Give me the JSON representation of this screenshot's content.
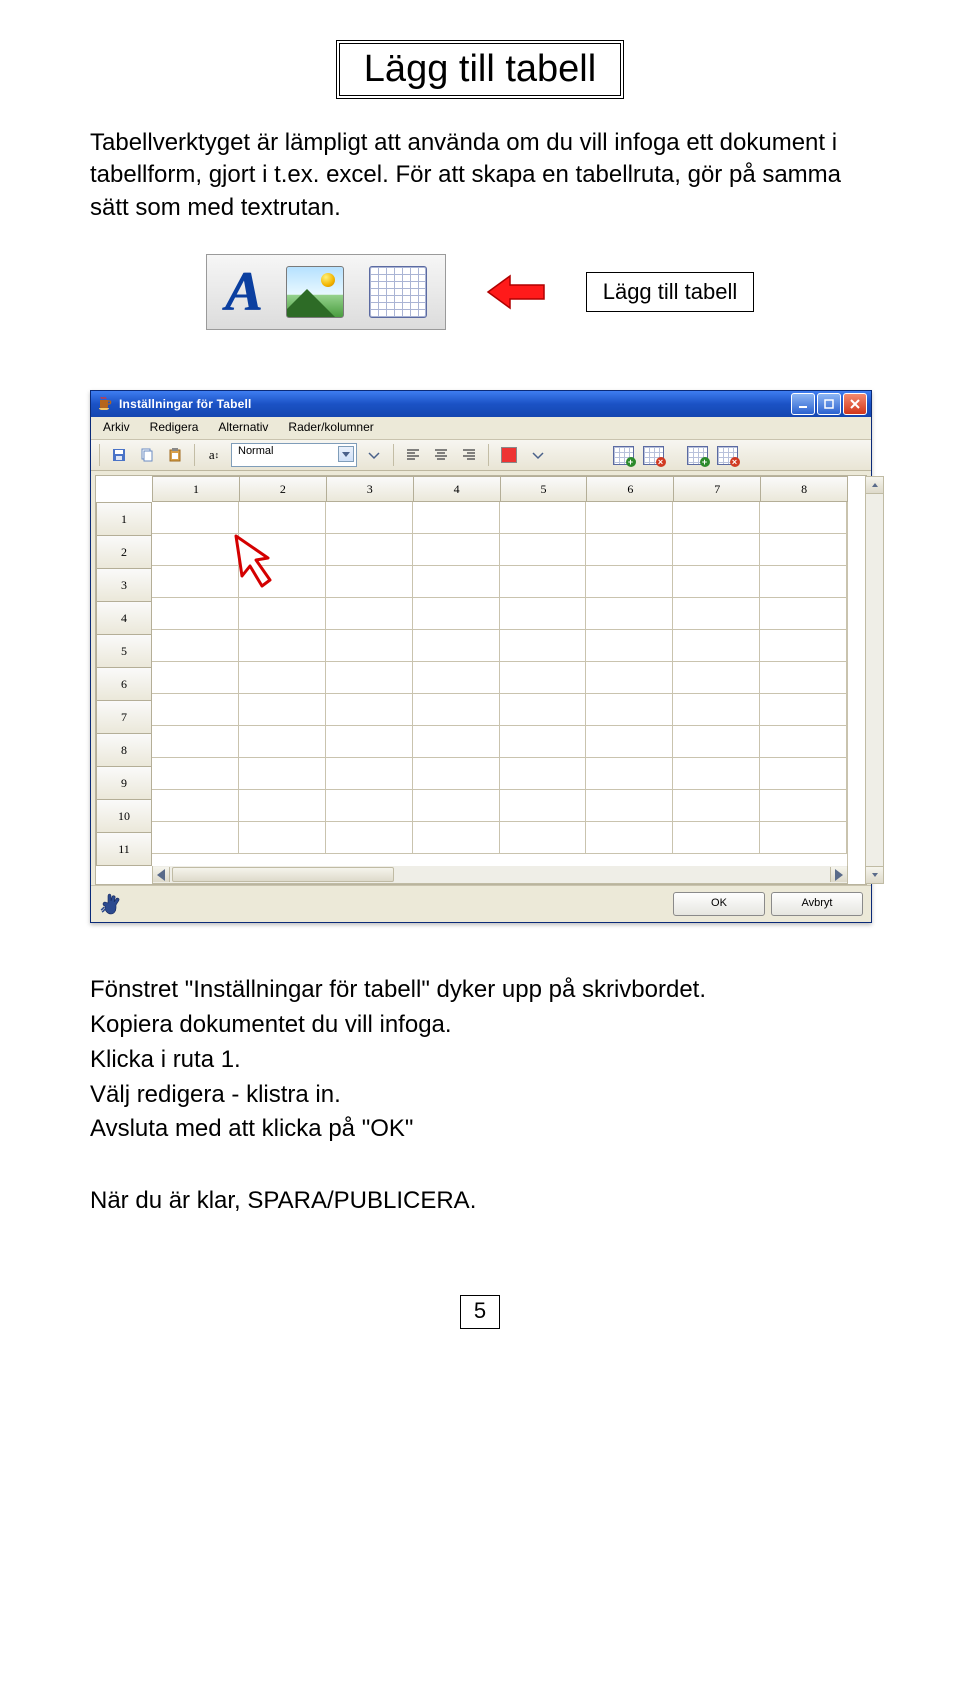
{
  "title": "Lägg till tabell",
  "intro": "Tabellverktyget är lämpligt att använda om du vill infoga ett dokument i tabellform, gjort i t.ex. excel. För att skapa en tabellruta, gör på samma sätt som med textrutan.",
  "callout_label": "Lägg till tabell",
  "window": {
    "title": "Inställningar för Tabell",
    "menu": [
      "Arkiv",
      "Redigera",
      "Alternativ",
      "Rader/kolumner"
    ],
    "style_combo": "Normal",
    "col_headers": [
      "1",
      "2",
      "3",
      "4",
      "5",
      "6",
      "7",
      "8"
    ],
    "row_headers": [
      "1",
      "2",
      "3",
      "4",
      "5",
      "6",
      "7",
      "8",
      "9",
      "10",
      "11"
    ],
    "ok": "OK",
    "cancel": "Avbryt"
  },
  "outro_lines": [
    "Fönstret \"Inställningar för tabell\" dyker upp på skrivbordet.",
    "Kopiera  dokumentet du vill infoga.",
    "Klicka i ruta 1.",
    "Välj redigera - klistra in.",
    "Avsluta med att klicka på \"OK\""
  ],
  "last_line": "När du är klar, SPARA/PUBLICERA.",
  "page_number": "5",
  "icons": {
    "text_tool": "A",
    "picture_tool": "picture-icon",
    "table_tool": "table-grid-icon"
  }
}
